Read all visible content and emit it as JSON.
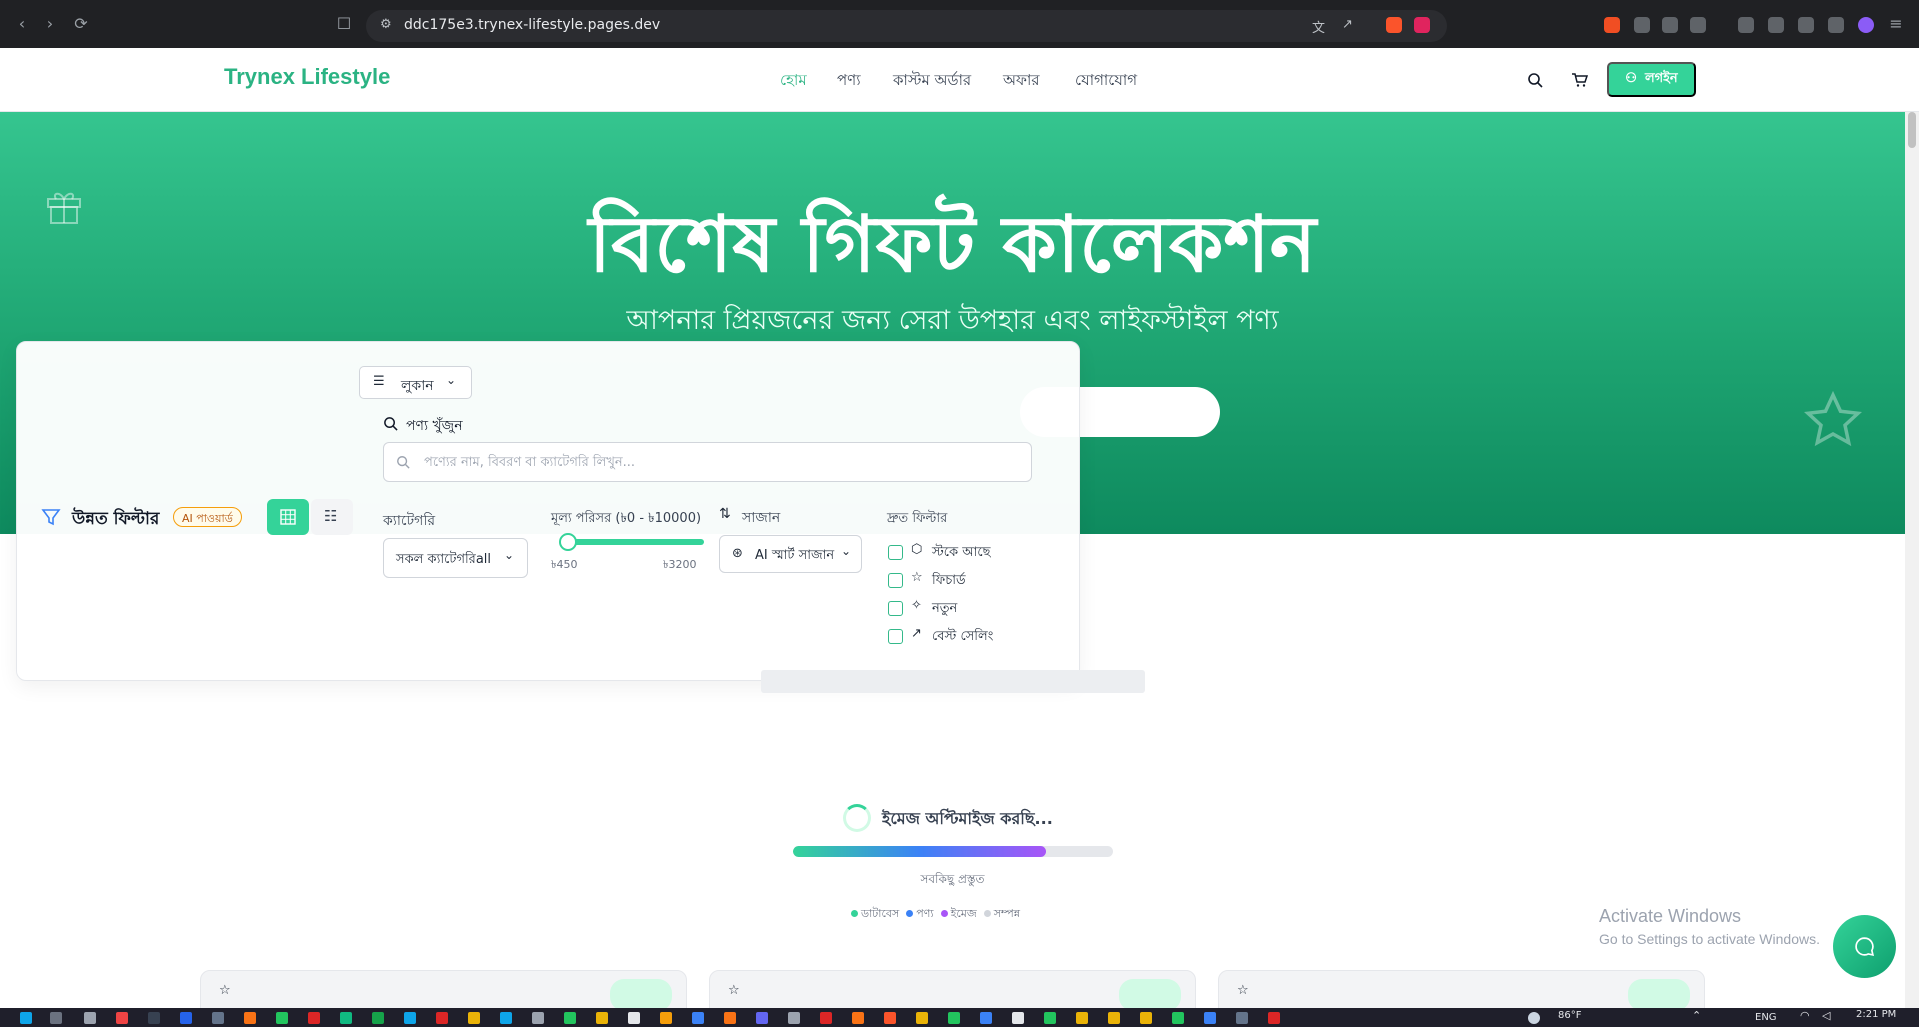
{
  "browser": {
    "url": "ddc175e3.trynex-lifestyle.pages.dev"
  },
  "header": {
    "brand": "Trynex Lifestyle",
    "nav": [
      "হোম",
      "পণ্য",
      "কাস্টম অর্ডার",
      "অফার",
      "যোগাযোগ"
    ],
    "login_label": "লগইন"
  },
  "hero": {
    "title": "বিশেষ গিফট কালেকশন",
    "subtitle": "আপনার প্রিয়জনের জন্য সেরা উপহার এবং লাইফস্টাইল পণ্য"
  },
  "filter": {
    "title": "উন্নত ফিল্টার",
    "ai_badge": "AI পাওয়ার্ড",
    "hide_label": "লুকান",
    "search_label": "পণ্য খুঁজুন",
    "search_placeholder": "পণ্যের নাম, বিবরণ বা ক্যাটেগরি লিখুন...",
    "category_label": "ক্যাটেগরি",
    "category_value": "সকল ক্যাটেগরিall",
    "price_label": "মূল্য পরিসর (৳0 - ৳10000)",
    "price_min": "৳450",
    "price_max": "৳3200",
    "sort_label": "সাজান",
    "sort_value": "AI স্মার্ট সাজান",
    "quick_label": "দ্রুত ফিল্টার",
    "quick": [
      "স্টকে আছে",
      "ফিচার্ড",
      "নতুন",
      "বেস্ট সেলিং"
    ]
  },
  "loader": {
    "title": "ইমেজ অপ্টিমাইজ করছি...",
    "progress": 0.79,
    "status": "সবকিছু প্রস্তুত",
    "steps": [
      "ডাটাবেস",
      "পণ্য",
      "ইমেজ",
      "সম্পন্ন"
    ]
  },
  "watermark": {
    "line1": "Activate Windows",
    "line2": "Go to Settings to activate Windows."
  },
  "taskbar": {
    "weather": "86°F",
    "lang": "ENG",
    "time": "2:21 PM"
  },
  "colors": {
    "accent": "#34d399",
    "brand": "#2bb383",
    "progress_start": "#34d399",
    "progress_mid": "#3b82f6",
    "progress_end": "#a855f7"
  }
}
